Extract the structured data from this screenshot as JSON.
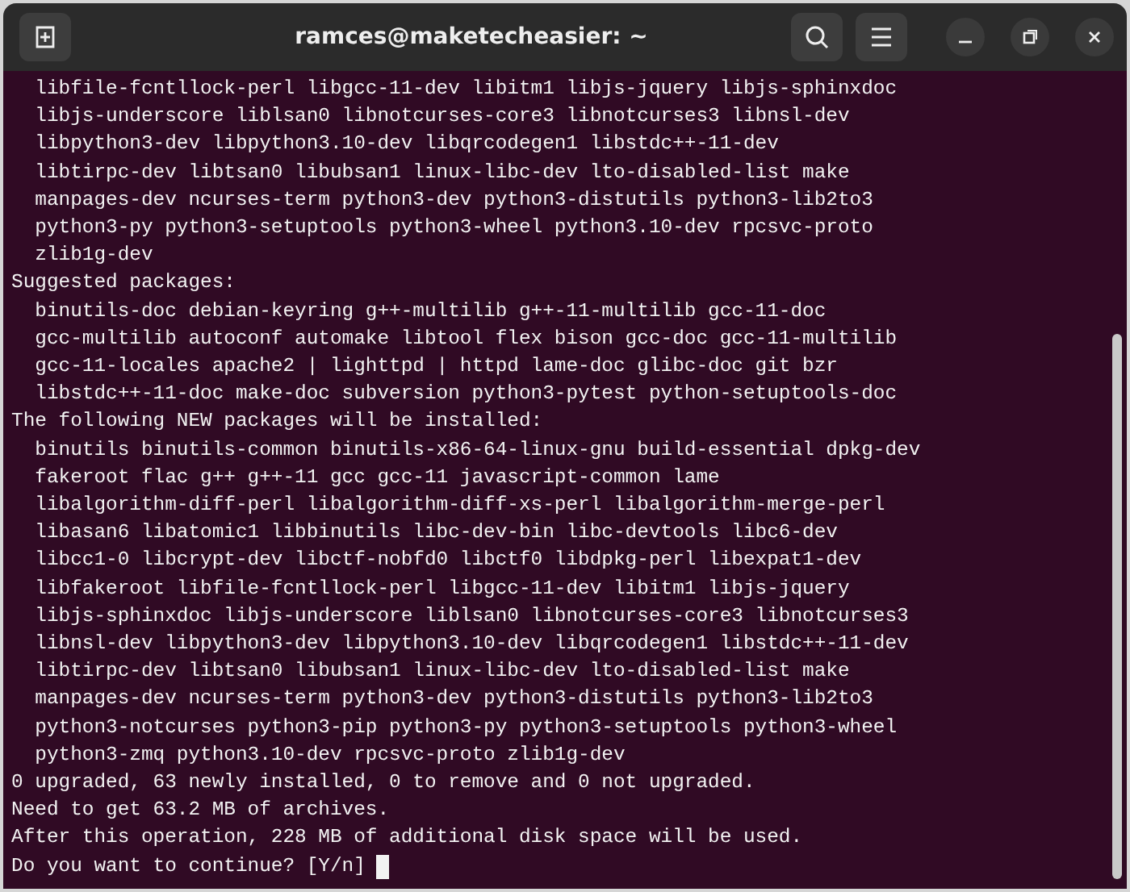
{
  "window": {
    "title": "ramces@maketecheasier: ~"
  },
  "terminal": {
    "cursor_visible": true,
    "lines": [
      "  libfile-fcntllock-perl libgcc-11-dev libitm1 libjs-jquery libjs-sphinxdoc",
      "  libjs-underscore liblsan0 libnotcurses-core3 libnotcurses3 libnsl-dev",
      "  libpython3-dev libpython3.10-dev libqrcodegen1 libstdc++-11-dev",
      "  libtirpc-dev libtsan0 libubsan1 linux-libc-dev lto-disabled-list make",
      "  manpages-dev ncurses-term python3-dev python3-distutils python3-lib2to3",
      "  python3-py python3-setuptools python3-wheel python3.10-dev rpcsvc-proto",
      "  zlib1g-dev",
      "Suggested packages:",
      "  binutils-doc debian-keyring g++-multilib g++-11-multilib gcc-11-doc",
      "  gcc-multilib autoconf automake libtool flex bison gcc-doc gcc-11-multilib",
      "  gcc-11-locales apache2 | lighttpd | httpd lame-doc glibc-doc git bzr",
      "  libstdc++-11-doc make-doc subversion python3-pytest python-setuptools-doc",
      "The following NEW packages will be installed:",
      "  binutils binutils-common binutils-x86-64-linux-gnu build-essential dpkg-dev",
      "  fakeroot flac g++ g++-11 gcc gcc-11 javascript-common lame",
      "  libalgorithm-diff-perl libalgorithm-diff-xs-perl libalgorithm-merge-perl",
      "  libasan6 libatomic1 libbinutils libc-dev-bin libc-devtools libc6-dev",
      "  libcc1-0 libcrypt-dev libctf-nobfd0 libctf0 libdpkg-perl libexpat1-dev",
      "  libfakeroot libfile-fcntllock-perl libgcc-11-dev libitm1 libjs-jquery",
      "  libjs-sphinxdoc libjs-underscore liblsan0 libnotcurses-core3 libnotcurses3",
      "  libnsl-dev libpython3-dev libpython3.10-dev libqrcodegen1 libstdc++-11-dev",
      "  libtirpc-dev libtsan0 libubsan1 linux-libc-dev lto-disabled-list make",
      "  manpages-dev ncurses-term python3-dev python3-distutils python3-lib2to3",
      "  python3-notcurses python3-pip python3-py python3-setuptools python3-wheel",
      "  python3-zmq python3.10-dev rpcsvc-proto zlib1g-dev",
      "0 upgraded, 63 newly installed, 0 to remove and 0 not upgraded.",
      "Need to get 63.2 MB of archives.",
      "After this operation, 228 MB of additional disk space will be used.",
      "Do you want to continue? [Y/n]"
    ]
  }
}
